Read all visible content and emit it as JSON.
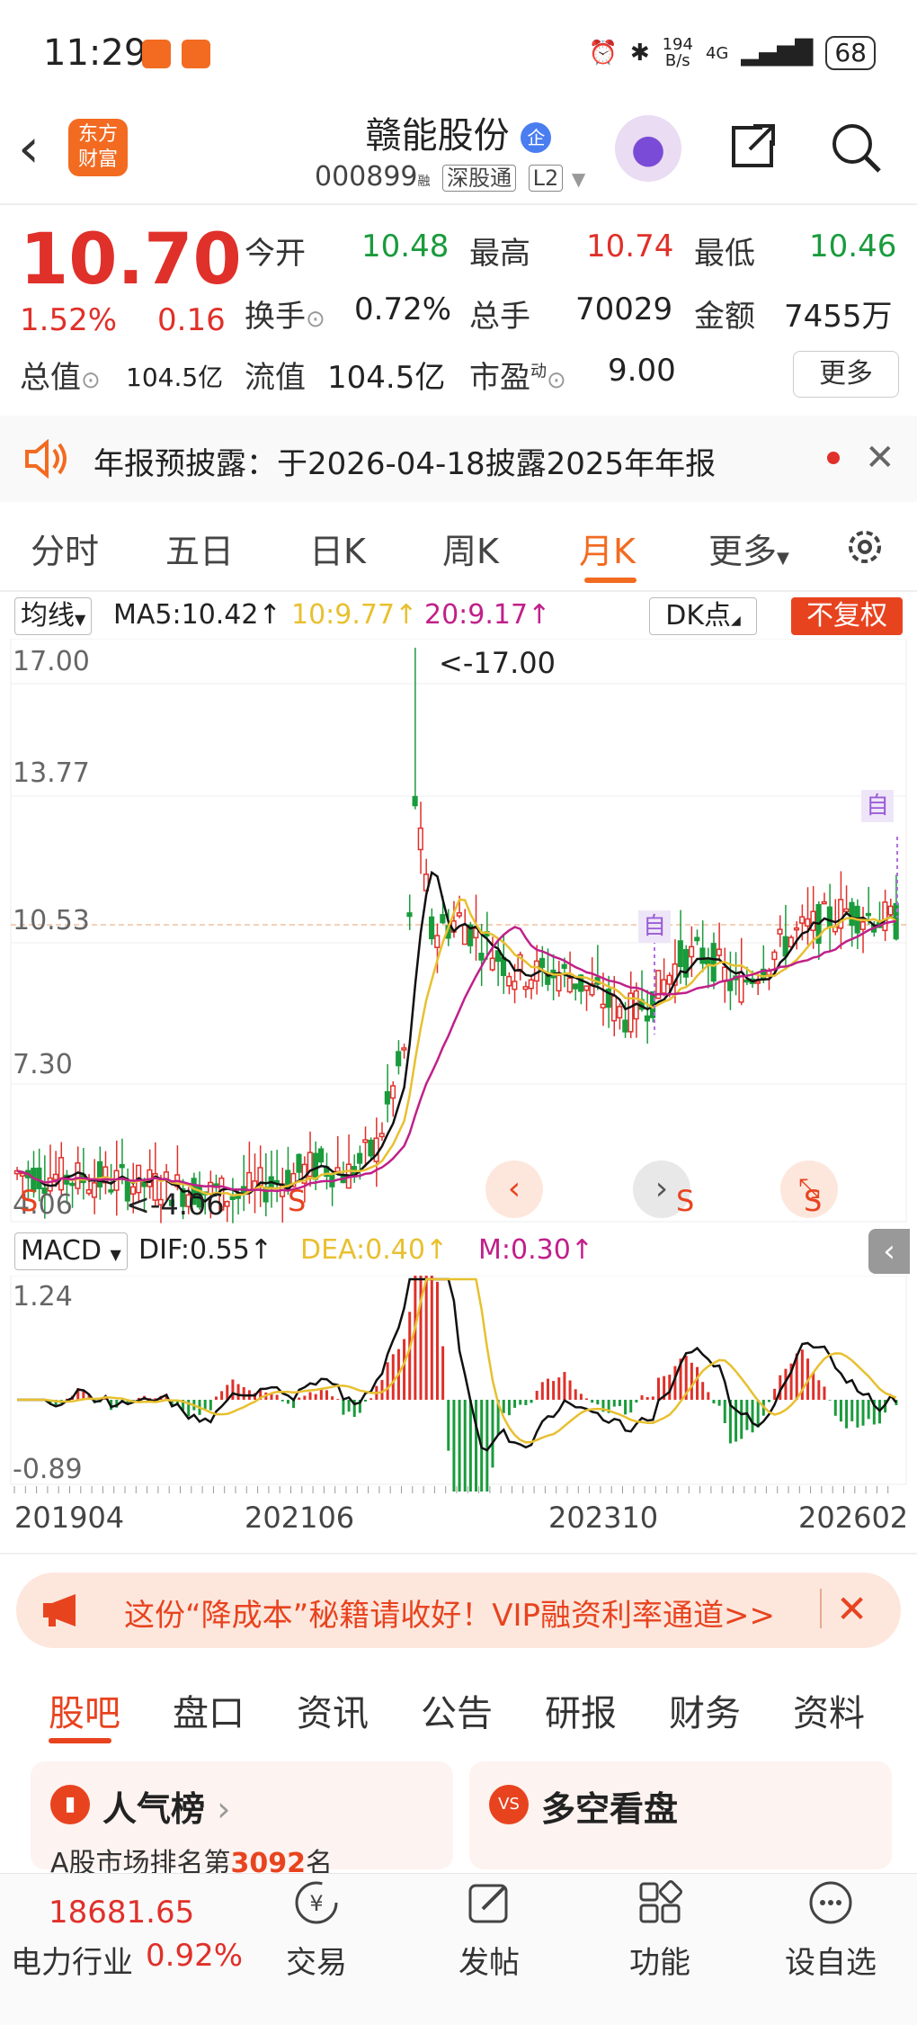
{
  "status_bar": {
    "time": "11:29",
    "net_speed_top": "194",
    "net_speed_bottom": "B/s",
    "signal": "4G",
    "battery": "68"
  },
  "header": {
    "logo_line1": "东方",
    "logo_line2": "财富",
    "stock_name": "赣能股份",
    "badge": "企",
    "code": "000899",
    "code_suffix": "融",
    "tag1": "深股通",
    "tag2": "L2"
  },
  "quote": {
    "price": "10.70",
    "pct": "1.52%",
    "change": "0.16",
    "open_label": "今开",
    "open": "10.48",
    "high_label": "最高",
    "high": "10.74",
    "low_label": "最低",
    "low": "10.46",
    "turnover_label": "换手",
    "turnover": "0.72%",
    "volume_label": "总手",
    "volume": "70029",
    "amount_label": "金额",
    "amount": "7455万",
    "mcap_label": "总值",
    "mcap": "104.5亿",
    "float_label": "流值",
    "float": "104.5亿",
    "pe_label": "市盈",
    "pe_sup": "动",
    "pe": "9.00",
    "more_label": "更多"
  },
  "notice": {
    "text": "年报预披露：于2026-04-18披露2025年年报"
  },
  "tabs": [
    "分时",
    "五日",
    "日K",
    "周K",
    "月K",
    "更多"
  ],
  "active_tab": "月K",
  "kline_toolbar": {
    "indicator": "均线",
    "ma5": "MA5:10.42↑",
    "ma10": "10:9.77↑",
    "ma20": "20:9.17↑",
    "dk": "DK点",
    "adjust": "不复权"
  },
  "macd_toolbar": {
    "indicator": "MACD",
    "dif": "DIF:0.55↑",
    "dea": "DEA:0.40↑",
    "m": "M:0.30↑"
  },
  "chart_data": {
    "type": "candlestick",
    "y_ticks": [
      "17.00",
      "13.77",
      "10.53",
      "7.30",
      "4.06"
    ],
    "annotations": {
      "high_label": "<-17.00",
      "low_label": "<-4.06",
      "self_marker": "自",
      "s_marker": "S"
    },
    "macd_ticks": [
      "1.24",
      "-0.89"
    ],
    "x_ticks": [
      "201904",
      "202106",
      "202310",
      "202602"
    ],
    "colors": {
      "up": "#e0302a",
      "down": "#1a9b3c",
      "ma5": "#111111",
      "ma10": "#e8c030",
      "ma20": "#c0208a"
    }
  },
  "ad": {
    "text": "这份“降成本”秘籍请收好！VIP融资利率通道>>"
  },
  "bottom_tabs": [
    "股吧",
    "盘口",
    "资讯",
    "公告",
    "研报",
    "财务",
    "资料"
  ],
  "cards": {
    "left_title": "人气榜",
    "left_sub": "A股市场排名第",
    "left_rank": "3092",
    "left_unit": "名",
    "right_title": "多空看盘",
    "right_icon": "VS"
  },
  "bottom_bar": {
    "index_value": "18681.65",
    "industry": "电力行业",
    "industry_pct": "0.92%",
    "nav": [
      "交易",
      "发帖",
      "功能",
      "设自选"
    ]
  }
}
